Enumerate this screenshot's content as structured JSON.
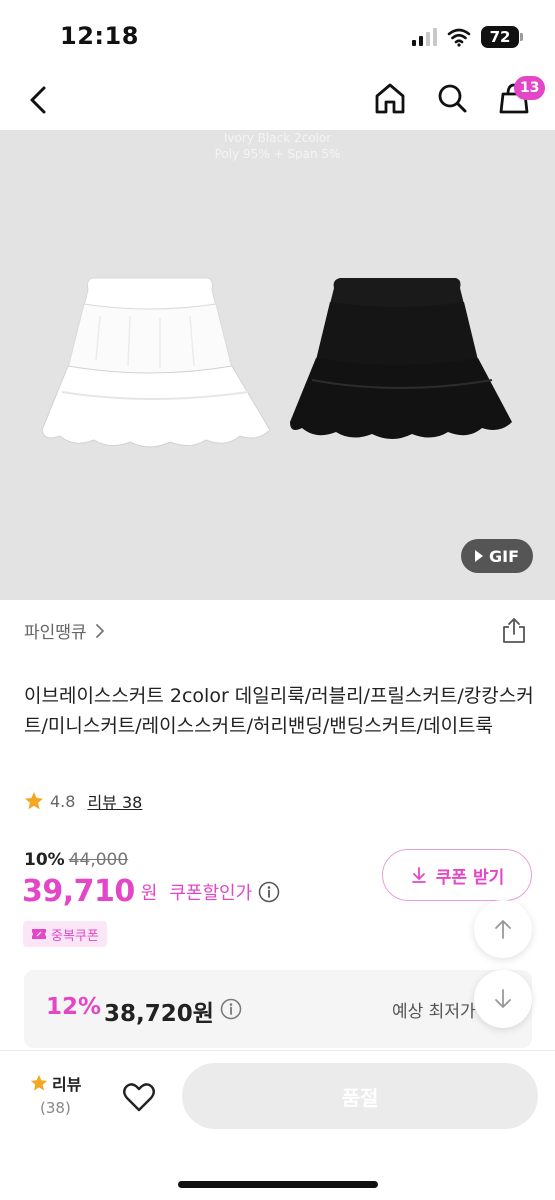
{
  "status_bar": {
    "time": "12:18",
    "battery": "72"
  },
  "nav": {
    "cart_count": "13"
  },
  "image": {
    "caption_line1": "Ivory  Black 2color",
    "caption_line2": "Poly 95% + Span 5%",
    "gif_label": "GIF"
  },
  "brand": {
    "name": "파인땡큐"
  },
  "product": {
    "title": "이브레이스스커트 2color 데일리룩/러블리/프릴스커트/캉캉스커트/미니스커트/레이스스커트/허리밴딩/밴딩스커트/데이트룩",
    "rating": "4.8",
    "review_link": "리뷰 38"
  },
  "price": {
    "discount_rate": "10%",
    "original": "44,000",
    "sale": "39,710",
    "unit": "원",
    "coupon_price_label": "쿠폰할인가",
    "coupon_button": "쿠폰 받기",
    "dup_coupon": "중복쿠폰"
  },
  "lowest": {
    "rate": "12%",
    "price": "38,720원",
    "label": "예상 최저가"
  },
  "bottom": {
    "review_label": "리뷰",
    "review_count": "(38)",
    "soldout": "품절"
  },
  "colors": {
    "accent": "#e347c8",
    "star": "#f5a623"
  }
}
